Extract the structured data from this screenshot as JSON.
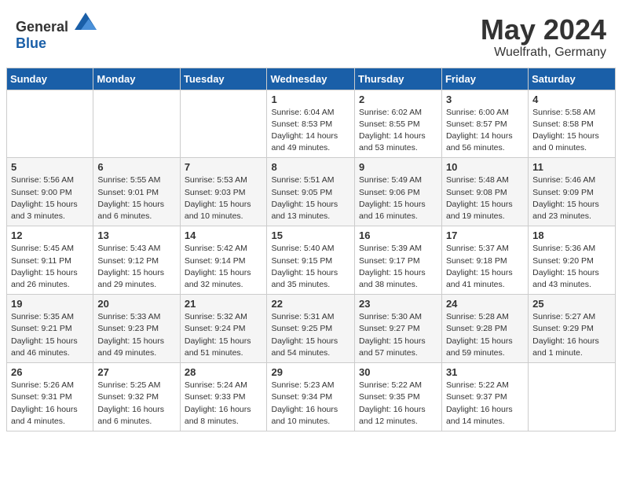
{
  "header": {
    "logo_general": "General",
    "logo_blue": "Blue",
    "month": "May 2024",
    "location": "Wuelfrath, Germany"
  },
  "weekdays": [
    "Sunday",
    "Monday",
    "Tuesday",
    "Wednesday",
    "Thursday",
    "Friday",
    "Saturday"
  ],
  "weeks": [
    [
      {
        "day": "",
        "info": ""
      },
      {
        "day": "",
        "info": ""
      },
      {
        "day": "",
        "info": ""
      },
      {
        "day": "1",
        "info": "Sunrise: 6:04 AM\nSunset: 8:53 PM\nDaylight: 14 hours\nand 49 minutes."
      },
      {
        "day": "2",
        "info": "Sunrise: 6:02 AM\nSunset: 8:55 PM\nDaylight: 14 hours\nand 53 minutes."
      },
      {
        "day": "3",
        "info": "Sunrise: 6:00 AM\nSunset: 8:57 PM\nDaylight: 14 hours\nand 56 minutes."
      },
      {
        "day": "4",
        "info": "Sunrise: 5:58 AM\nSunset: 8:58 PM\nDaylight: 15 hours\nand 0 minutes."
      }
    ],
    [
      {
        "day": "5",
        "info": "Sunrise: 5:56 AM\nSunset: 9:00 PM\nDaylight: 15 hours\nand 3 minutes."
      },
      {
        "day": "6",
        "info": "Sunrise: 5:55 AM\nSunset: 9:01 PM\nDaylight: 15 hours\nand 6 minutes."
      },
      {
        "day": "7",
        "info": "Sunrise: 5:53 AM\nSunset: 9:03 PM\nDaylight: 15 hours\nand 10 minutes."
      },
      {
        "day": "8",
        "info": "Sunrise: 5:51 AM\nSunset: 9:05 PM\nDaylight: 15 hours\nand 13 minutes."
      },
      {
        "day": "9",
        "info": "Sunrise: 5:49 AM\nSunset: 9:06 PM\nDaylight: 15 hours\nand 16 minutes."
      },
      {
        "day": "10",
        "info": "Sunrise: 5:48 AM\nSunset: 9:08 PM\nDaylight: 15 hours\nand 19 minutes."
      },
      {
        "day": "11",
        "info": "Sunrise: 5:46 AM\nSunset: 9:09 PM\nDaylight: 15 hours\nand 23 minutes."
      }
    ],
    [
      {
        "day": "12",
        "info": "Sunrise: 5:45 AM\nSunset: 9:11 PM\nDaylight: 15 hours\nand 26 minutes."
      },
      {
        "day": "13",
        "info": "Sunrise: 5:43 AM\nSunset: 9:12 PM\nDaylight: 15 hours\nand 29 minutes."
      },
      {
        "day": "14",
        "info": "Sunrise: 5:42 AM\nSunset: 9:14 PM\nDaylight: 15 hours\nand 32 minutes."
      },
      {
        "day": "15",
        "info": "Sunrise: 5:40 AM\nSunset: 9:15 PM\nDaylight: 15 hours\nand 35 minutes."
      },
      {
        "day": "16",
        "info": "Sunrise: 5:39 AM\nSunset: 9:17 PM\nDaylight: 15 hours\nand 38 minutes."
      },
      {
        "day": "17",
        "info": "Sunrise: 5:37 AM\nSunset: 9:18 PM\nDaylight: 15 hours\nand 41 minutes."
      },
      {
        "day": "18",
        "info": "Sunrise: 5:36 AM\nSunset: 9:20 PM\nDaylight: 15 hours\nand 43 minutes."
      }
    ],
    [
      {
        "day": "19",
        "info": "Sunrise: 5:35 AM\nSunset: 9:21 PM\nDaylight: 15 hours\nand 46 minutes."
      },
      {
        "day": "20",
        "info": "Sunrise: 5:33 AM\nSunset: 9:23 PM\nDaylight: 15 hours\nand 49 minutes."
      },
      {
        "day": "21",
        "info": "Sunrise: 5:32 AM\nSunset: 9:24 PM\nDaylight: 15 hours\nand 51 minutes."
      },
      {
        "day": "22",
        "info": "Sunrise: 5:31 AM\nSunset: 9:25 PM\nDaylight: 15 hours\nand 54 minutes."
      },
      {
        "day": "23",
        "info": "Sunrise: 5:30 AM\nSunset: 9:27 PM\nDaylight: 15 hours\nand 57 minutes."
      },
      {
        "day": "24",
        "info": "Sunrise: 5:28 AM\nSunset: 9:28 PM\nDaylight: 15 hours\nand 59 minutes."
      },
      {
        "day": "25",
        "info": "Sunrise: 5:27 AM\nSunset: 9:29 PM\nDaylight: 16 hours\nand 1 minute."
      }
    ],
    [
      {
        "day": "26",
        "info": "Sunrise: 5:26 AM\nSunset: 9:31 PM\nDaylight: 16 hours\nand 4 minutes."
      },
      {
        "day": "27",
        "info": "Sunrise: 5:25 AM\nSunset: 9:32 PM\nDaylight: 16 hours\nand 6 minutes."
      },
      {
        "day": "28",
        "info": "Sunrise: 5:24 AM\nSunset: 9:33 PM\nDaylight: 16 hours\nand 8 minutes."
      },
      {
        "day": "29",
        "info": "Sunrise: 5:23 AM\nSunset: 9:34 PM\nDaylight: 16 hours\nand 10 minutes."
      },
      {
        "day": "30",
        "info": "Sunrise: 5:22 AM\nSunset: 9:35 PM\nDaylight: 16 hours\nand 12 minutes."
      },
      {
        "day": "31",
        "info": "Sunrise: 5:22 AM\nSunset: 9:37 PM\nDaylight: 16 hours\nand 14 minutes."
      },
      {
        "day": "",
        "info": ""
      }
    ]
  ]
}
